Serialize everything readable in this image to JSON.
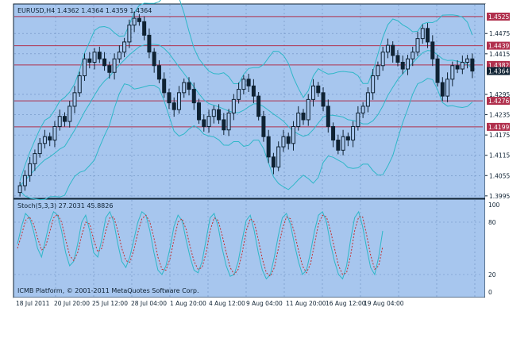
{
  "colors": {
    "panel_bg": "#a7c6ee",
    "grid": "#6d8fc2",
    "candle": "#0f2233",
    "bollinger": "#2fb7c8",
    "hline": "#b0304d",
    "price_label_bg": "#b0304d",
    "current_price_bg": "#0f2233",
    "stoch_main": "#2fb7c8",
    "stoch_signal": "#c03030",
    "scale_text": "#0f2233"
  },
  "chart": {
    "title": "EURUSD,H4  1.4362 1.4364 1.4359 1.4364",
    "copyright": "ICMB Platform, © 2001-2011 MetaQuotes Software Corp."
  },
  "chart_data": [
    {
      "type": "candlestick",
      "symbol": "EURUSD",
      "timeframe": "H4",
      "ylim": [
        1.399,
        1.456
      ],
      "y_ticks": [
        "1.4475",
        "1.4415",
        "1.4295",
        "1.4235",
        "1.4175",
        "1.4115",
        "1.4055",
        "1.3995"
      ],
      "price_levels": [
        "1.4525",
        "1.4439",
        "1.4382",
        "1.4276",
        "1.4199"
      ],
      "current_price": "1.4364",
      "x_ticks": [
        "18 Jul 2011",
        "20 Jul 20:00",
        "25 Jul 12:00",
        "28 Jul 04:00",
        "1 Aug 20:00",
        "4 Aug 12:00",
        "9 Aug 04:00",
        "11 Aug 20:00",
        "16 Aug 12:00",
        "19 Aug 04:00"
      ],
      "closes": [
        1.4025,
        1.4055,
        1.409,
        1.412,
        1.415,
        1.417,
        1.416,
        1.42,
        1.423,
        1.4215,
        1.426,
        1.43,
        1.435,
        1.44,
        1.439,
        1.442,
        1.44,
        1.438,
        1.436,
        1.44,
        1.442,
        1.445,
        1.45,
        1.452,
        1.451,
        1.447,
        1.442,
        1.438,
        1.434,
        1.43,
        1.427,
        1.425,
        1.43,
        1.433,
        1.431,
        1.427,
        1.422,
        1.42,
        1.423,
        1.425,
        1.422,
        1.419,
        1.424,
        1.428,
        1.431,
        1.434,
        1.432,
        1.429,
        1.423,
        1.417,
        1.411,
        1.408,
        1.414,
        1.417,
        1.415,
        1.42,
        1.424,
        1.422,
        1.428,
        1.432,
        1.43,
        1.426,
        1.42,
        1.416,
        1.413,
        1.417,
        1.416,
        1.42,
        1.424,
        1.426,
        1.43,
        1.435,
        1.438,
        1.442,
        1.444,
        1.441,
        1.439,
        1.437,
        1.44,
        1.442,
        1.446,
        1.449,
        1.445,
        1.44,
        1.433,
        1.429,
        1.434,
        1.438,
        1.437,
        1.439,
        1.44,
        1.4364
      ],
      "stoch_main": [
        55,
        75,
        90,
        85,
        70,
        50,
        40,
        60,
        80,
        92,
        88,
        70,
        45,
        30,
        35,
        55,
        80,
        88,
        70,
        45,
        40,
        60,
        85,
        92,
        80,
        55,
        35,
        28,
        40,
        60,
        80,
        92,
        88,
        70,
        45,
        25,
        20,
        30,
        50,
        75,
        88,
        82,
        60,
        40,
        25,
        22,
        35,
        60,
        85,
        90,
        75,
        50,
        30,
        18,
        20,
        35,
        60,
        82,
        88,
        70,
        45,
        25,
        15,
        20,
        40,
        65,
        85,
        90,
        78,
        55,
        35,
        20,
        25,
        45,
        70,
        88,
        92,
        80,
        55,
        35,
        20,
        15,
        30,
        60,
        85,
        92,
        75,
        50,
        28,
        20,
        40,
        70
      ],
      "stoch_signal": [
        50,
        65,
        82,
        86,
        78,
        62,
        48,
        52,
        68,
        85,
        89,
        80,
        60,
        42,
        36,
        45,
        65,
        80,
        78,
        60,
        46,
        50,
        70,
        85,
        86,
        70,
        50,
        36,
        34,
        48,
        68,
        84,
        88,
        80,
        62,
        40,
        26,
        25,
        38,
        60,
        80,
        84,
        72,
        52,
        35,
        26,
        28,
        45,
        70,
        85,
        82,
        65,
        45,
        28,
        20,
        26,
        45,
        70,
        84,
        80,
        60,
        38,
        22,
        18,
        28,
        50,
        72,
        86,
        84,
        68,
        48,
        30,
        22,
        32,
        55,
        78,
        88,
        86,
        70,
        50,
        30,
        20,
        22,
        42,
        70,
        86,
        86,
        65,
        42,
        26,
        30,
        52
      ],
      "stoch_levels": [
        "100",
        "80",
        "20",
        "0"
      ]
    }
  ],
  "stoch": {
    "label": "Stoch(5,3,3) 27.2031 45.8826"
  }
}
